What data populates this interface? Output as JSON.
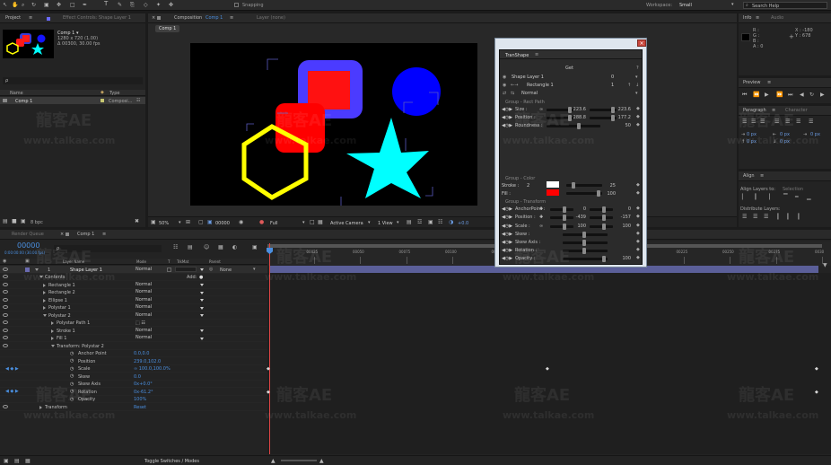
{
  "menubar": {
    "snapping": "Snapping",
    "workspace_label": "Workspace:",
    "workspace_value": "Small",
    "search_help": "Search Help"
  },
  "project_panel": {
    "tab_project": "Project",
    "tab_effect_controls": "Effect Controls: Shape Layer 1",
    "thumb_title": "Comp 1 ▾",
    "thumb_size": "1280 x 720 (1.00)",
    "thumb_duration": "Δ 00300, 30.00 fps",
    "search_placeholder": "ρ",
    "col_name": "Name",
    "col_type": "Type",
    "items": [
      {
        "name": "Comp 1",
        "type": "Composi..."
      }
    ],
    "bpc": "8 bpc"
  },
  "comp_viewer": {
    "tab_composition": "Composition",
    "tab_comp_name": "Comp 1",
    "tab_layer": "Layer (none)",
    "breadcrumb": "Comp 1",
    "zoom": "50%",
    "timecode": "00000",
    "resolution": "Full",
    "camera": "Active Camera",
    "view": "1 View",
    "exposure": "+0.0"
  },
  "info_panel": {
    "tab_info": "Info",
    "tab_audio": "Audio",
    "r": "R :",
    "g": "G :",
    "b": "B :",
    "a": "A : 0",
    "x": "X : -180",
    "y": "Y : 678"
  },
  "preview_panel": {
    "tab": "Preview"
  },
  "paragraph_panel": {
    "tab_paragraph": "Paragraph",
    "tab_character": "Character",
    "px": [
      "0 px",
      "0 px",
      "0 px",
      "0 px",
      "0 px"
    ]
  },
  "align_panel": {
    "tab": "Align",
    "align_layers_to": "Align Layers to:",
    "selection": "Selection",
    "distribute": "Distribute Layers:"
  },
  "timeline": {
    "tab_render_queue": "Render Queue",
    "tab_comp": "Comp 1",
    "timecode": "00000",
    "timecode_sub": "0:00:00:00 (30.00 fps)",
    "search_placeholder": "ρ",
    "col_layer_name": "Layer Name",
    "col_mode": "Mode",
    "col_t": "T",
    "col_trkmat": "TrkMat",
    "col_parent": "Parent",
    "toggle": "Toggle Switches / Modes",
    "ruler": [
      "00025",
      "00050",
      "00075",
      "00100",
      "00125",
      "00150",
      "00175",
      "00200",
      "00225",
      "00250",
      "00275",
      "0030"
    ],
    "rows": [
      {
        "indent": 0,
        "label": "Shape Layer 1",
        "num": "1",
        "mode": "Normal",
        "trkmat": "",
        "parent": "None",
        "type": "layer"
      },
      {
        "indent": 1,
        "label": "Contents",
        "add": "Add:",
        "type": "group"
      },
      {
        "indent": 2,
        "label": "Rectangle 1",
        "mode": "Normal",
        "type": "sub"
      },
      {
        "indent": 2,
        "label": "Rectangle 2",
        "mode": "Normal",
        "type": "sub"
      },
      {
        "indent": 2,
        "label": "Ellipse 1",
        "mode": "Normal",
        "type": "sub"
      },
      {
        "indent": 2,
        "label": "Polystar 1",
        "mode": "Normal",
        "type": "sub"
      },
      {
        "indent": 2,
        "label": "Polystar 2",
        "mode": "Normal",
        "type": "subopen"
      },
      {
        "indent": 3,
        "label": "Polystar Path 1",
        "type": "path"
      },
      {
        "indent": 3,
        "label": "Stroke 1",
        "mode": "Normal",
        "type": "sub"
      },
      {
        "indent": 3,
        "label": "Fill 1",
        "mode": "Normal",
        "type": "sub"
      },
      {
        "indent": 3,
        "label": "Transform: Polystar 2",
        "type": "subopen"
      },
      {
        "indent": 4,
        "label": "Anchor Point",
        "value": "0.0,0.0",
        "type": "prop"
      },
      {
        "indent": 4,
        "label": "Position",
        "value": "239.0,102.0",
        "type": "prop"
      },
      {
        "indent": 4,
        "label": "Scale",
        "value": "∞ 100.0,100.0%",
        "type": "prop",
        "keyed": true
      },
      {
        "indent": 4,
        "label": "Skew",
        "value": "0.0",
        "type": "prop"
      },
      {
        "indent": 4,
        "label": "Skew Axis",
        "value": "0x+0.0°",
        "type": "prop"
      },
      {
        "indent": 4,
        "label": "Rotation",
        "value": "0x-61.2°",
        "type": "prop",
        "keyed": true
      },
      {
        "indent": 4,
        "label": "Opacity",
        "value": "100%",
        "type": "prop"
      },
      {
        "indent": 1,
        "label": "Transform",
        "value": "Reset",
        "type": "group"
      }
    ]
  },
  "transhape": {
    "tab": "TranShape",
    "get": "Get",
    "help": "?",
    "layer_name": "Shape Layer 1",
    "layer_num": "0",
    "group_name": "Rectangle 1",
    "group_num": "1",
    "blend": "Normal",
    "section_path": "Group - Rect Path",
    "size_label": "Size :",
    "size_x": "223.6",
    "size_y": "223.6",
    "position_label": "Position :",
    "position_x": "288.8",
    "position_y": "177.2",
    "roundness_label": "Roundness :",
    "roundness": "50",
    "section_color": "Group - Color",
    "stroke_label": "Stroke :",
    "stroke_width": "2",
    "stroke_opacity": "25",
    "fill_label": "Fill :",
    "fill_opacity": "100",
    "section_transform": "Group - Transform",
    "anchor_label": "AnchorPoint :",
    "anchor_x": "0",
    "anchor_y": "0",
    "tposition_label": "Position :",
    "tposition_x": "-439",
    "tposition_y": "-157",
    "scale_label": "Scale :",
    "scale_x": "100",
    "scale_y": "100",
    "skew_label": "Skew :",
    "skewaxis_label": "Skew Axis :",
    "rotation_label": "Rotation :",
    "opacity_label": "Opacity :",
    "opacity": "100",
    "stroke_color": "#ffffff",
    "fill_color": "#ff0000"
  },
  "watermark": {
    "brand": "龍客AE",
    "url": "www.talkae.com"
  },
  "colors": {
    "accent": "#4a8fe0",
    "red": "#ff0000",
    "blue": "#0000ff",
    "cyan": "#00ffff",
    "yellow": "#ffff00",
    "purple": "#4b3bff"
  }
}
